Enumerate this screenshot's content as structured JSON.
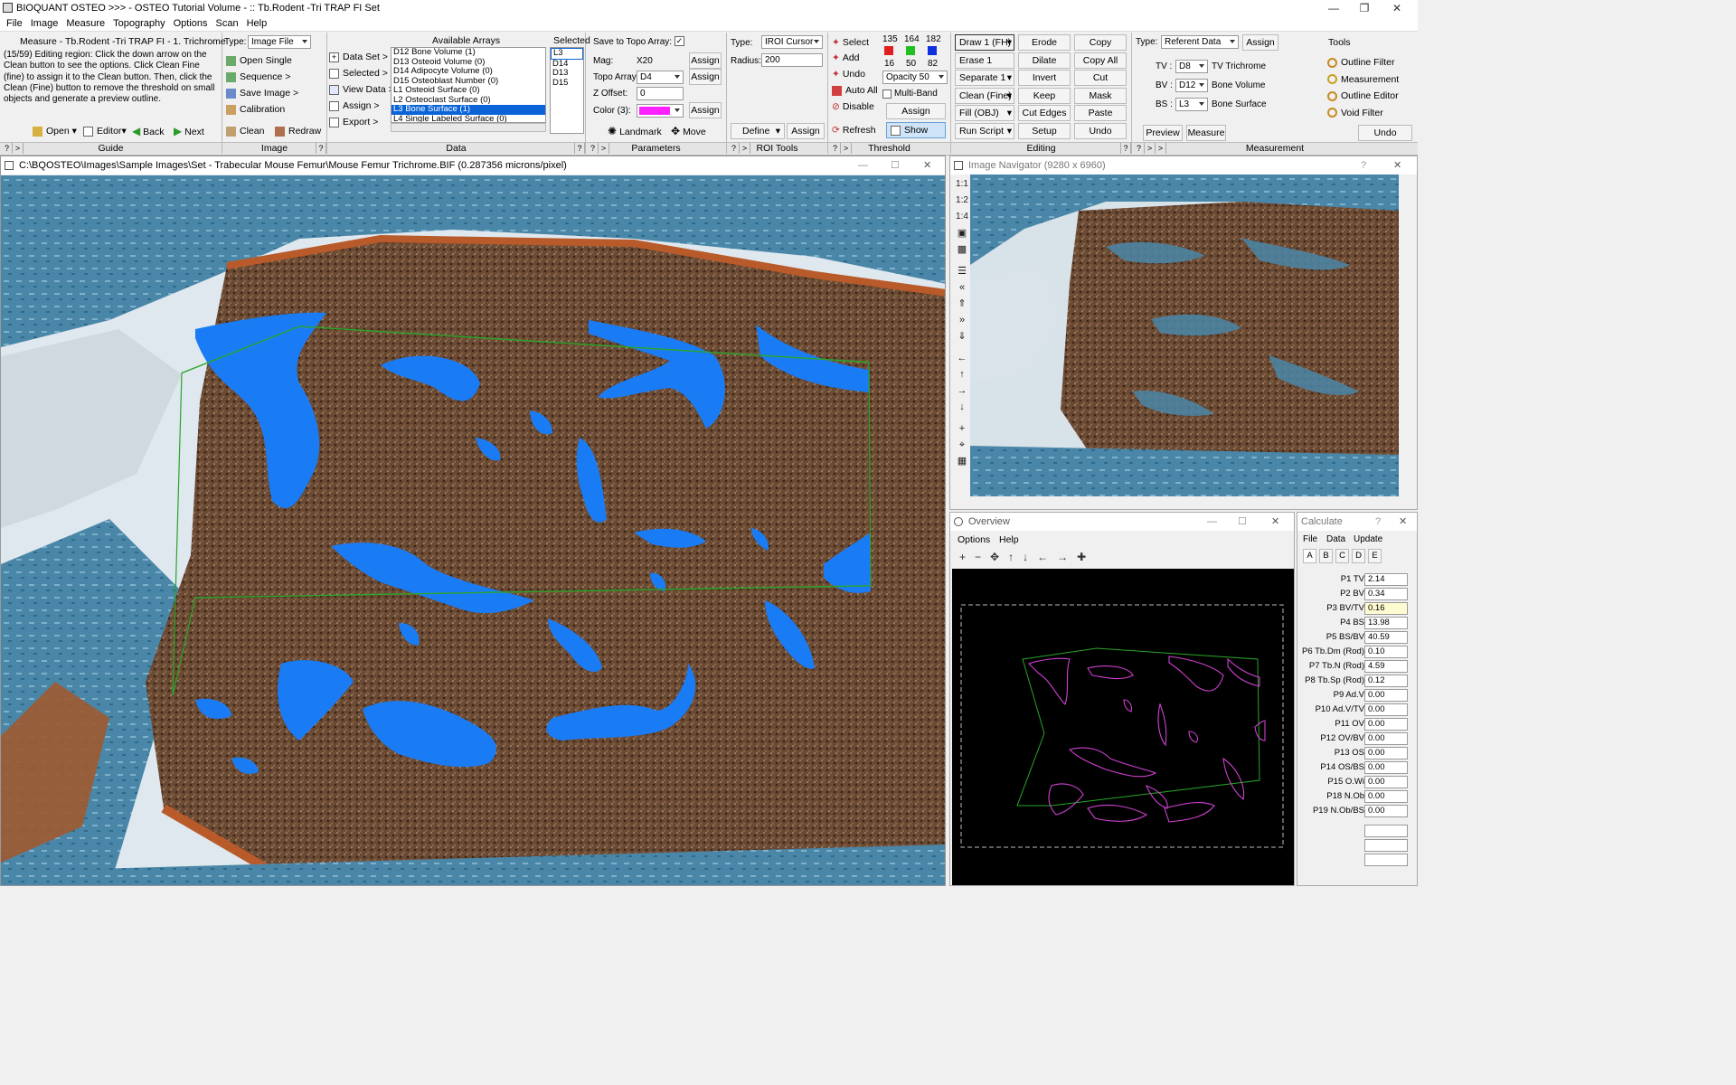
{
  "app": {
    "title": "BIOQUANT OSTEO >>> - OSTEO Tutorial Volume - :: Tb.Rodent -Tri TRAP FI Set"
  },
  "menu": [
    "File",
    "Image",
    "Measure",
    "Topography",
    "Options",
    "Scan",
    "Help"
  ],
  "guide": {
    "title": "Measure - Tb.Rodent -Tri TRAP FI - 1. Trichrome",
    "text": "(15/59) Editing region: Click the down arrow on the Clean button to see the options. Click Clean Fine (fine) to assign it to the Clean button. Then, click the Clean (Fine) button to remove the threshold on small objects and generate a preview outline.",
    "open": "Open",
    "editor": "Editor",
    "back": "Back",
    "next": "Next",
    "label": "Guide"
  },
  "image_panel": {
    "type_label": "Type:",
    "type_value": "Image File",
    "open_single": "Open Single",
    "sequence": "Sequence >",
    "save_image": "Save Image >",
    "calibration": "Calibration",
    "clean": "Clean",
    "redraw": "Redraw",
    "label": "Image"
  },
  "data_panel": {
    "data_set": "Data Set >",
    "selected": "Selected >",
    "view_data": "View Data >",
    "assign": "Assign >",
    "export": "Export >",
    "available_title": "Available Arrays",
    "selected_title": "Selected",
    "available": [
      "D12 Bone Volume (1)",
      "D13 Osteoid Volume (0)",
      "D14 Adipocyte Volume (0)",
      "D15 Osteoblast Number (0)",
      "L1 Osteoid Surface (0)",
      "L2 Osteoclast Surface (0)",
      "L3 Bone Surface (1)",
      "L4 Single Labeled Surface (0)"
    ],
    "available_selected_index": 6,
    "selected_list": [
      "L3",
      "D14",
      "D13",
      "D15"
    ],
    "label": "Data"
  },
  "params": {
    "save_topo": "Save to Topo Array:",
    "mag_label": "Mag:",
    "mag_value": "X20",
    "topo_label": "Topo Array:",
    "topo_value": "D4",
    "zoffset_label": "Z Offset:",
    "zoffset_value": "0",
    "color_label": "Color (3):",
    "assign": "Assign",
    "landmark": "Landmark",
    "move": "Move",
    "label": "Parameters"
  },
  "roi": {
    "type_label": "Type:",
    "type_value": "IROI Cursor",
    "radius_label": "Radius:",
    "radius_value": "200",
    "define": "Define",
    "assign": "Assign",
    "label": "ROI Tools"
  },
  "threshold": {
    "select": "Select",
    "add": "Add",
    "undo": "Undo",
    "auto_all": "Auto All",
    "disable": "Disable",
    "refresh": "Refresh",
    "show": "Show",
    "rgb_top": [
      "135",
      "164",
      "182"
    ],
    "rgb_bottom": [
      "16",
      "50",
      "82"
    ],
    "opacity": "Opacity 50",
    "multiband": "Multi-Band",
    "assign": "Assign",
    "label": "Threshold",
    "colors": {
      "red": "#e02020",
      "green": "#20c020",
      "blue": "#1030e0"
    }
  },
  "editing": {
    "col1": [
      "Draw 1 (FH)",
      "Erase 1 (FH)",
      "Separate 1",
      "Clean (Fine)",
      "Fill (OBJ)",
      "Run Script"
    ],
    "col2": [
      "Erode",
      "Dilate",
      "Invert",
      "Keep",
      "Cut Edges",
      "Setup"
    ],
    "col3": [
      "Copy",
      "Copy All",
      "Cut",
      "Mask",
      "Paste",
      "Undo"
    ],
    "label": "Editing"
  },
  "measurement": {
    "type_label": "Type:",
    "type_value": "Referent Data",
    "assign": "Assign",
    "tools_title": "Tools",
    "rows": [
      {
        "key": "TV :",
        "val": "D8",
        "name": "TV Trichrome"
      },
      {
        "key": "BV :",
        "val": "D12",
        "name": "Bone Volume"
      },
      {
        "key": "BS :",
        "val": "L3",
        "name": "Bone Surface"
      }
    ],
    "tools": [
      "Outline Filter",
      "Measurement",
      "Outline Editor",
      "Void Filter"
    ],
    "preview": "Preview",
    "measure": "Measure",
    "undo": "Undo",
    "label": "Measurement"
  },
  "image_window": {
    "title": "C:\\BQOSTEO\\Images\\Sample Images\\Set - Trabecular Mouse Femur\\Mouse Femur Trichrome.BIF (0.287356 microns/pixel)"
  },
  "navigator": {
    "title": "Image Navigator (9280 x 6960)",
    "zoom": [
      "1:1",
      "1:2",
      "1:4"
    ]
  },
  "overview": {
    "title": "Overview",
    "menu": [
      "Options",
      "Help"
    ]
  },
  "calculate": {
    "title": "Calculate",
    "menu": [
      "File",
      "Data",
      "Update"
    ],
    "tabs": [
      "A",
      "B",
      "C",
      "D",
      "E"
    ],
    "rows": [
      {
        "label": "P1 TV",
        "value": "2.14"
      },
      {
        "label": "P2 BV",
        "value": "0.34"
      },
      {
        "label": "P3 BV/TV",
        "value": "0.16"
      },
      {
        "label": "P4 BS",
        "value": "13.98"
      },
      {
        "label": "P5 BS/BV",
        "value": "40.59"
      },
      {
        "label": "P6 Tb.Dm (Rod)",
        "value": "0.10"
      },
      {
        "label": "P7 Tb.N (Rod)",
        "value": "4.59"
      },
      {
        "label": "P8 Tb.Sp (Rod)",
        "value": "0.12"
      },
      {
        "label": "P9 Ad.V",
        "value": "0.00"
      },
      {
        "label": "P10 Ad.V/TV",
        "value": "0.00"
      },
      {
        "label": "P11 OV",
        "value": "0.00"
      },
      {
        "label": "P12 OV/BV",
        "value": "0.00"
      },
      {
        "label": "P13 OS",
        "value": "0.00"
      },
      {
        "label": "P14 OS/BS",
        "value": "0.00"
      },
      {
        "label": "P15 O.Wi",
        "value": "0.00"
      },
      {
        "label": "P18 N.Ob",
        "value": "0.00"
      },
      {
        "label": "P19 N.Ob/BS",
        "value": "0.00"
      }
    ]
  },
  "colors": {
    "threshold_overlay": "#1a7cf5",
    "roi_outline": "#2aa52a",
    "magenta_swatch": "#ff20ff",
    "bone_blue": "#4a86a8",
    "marrow": "#6b4a33"
  }
}
